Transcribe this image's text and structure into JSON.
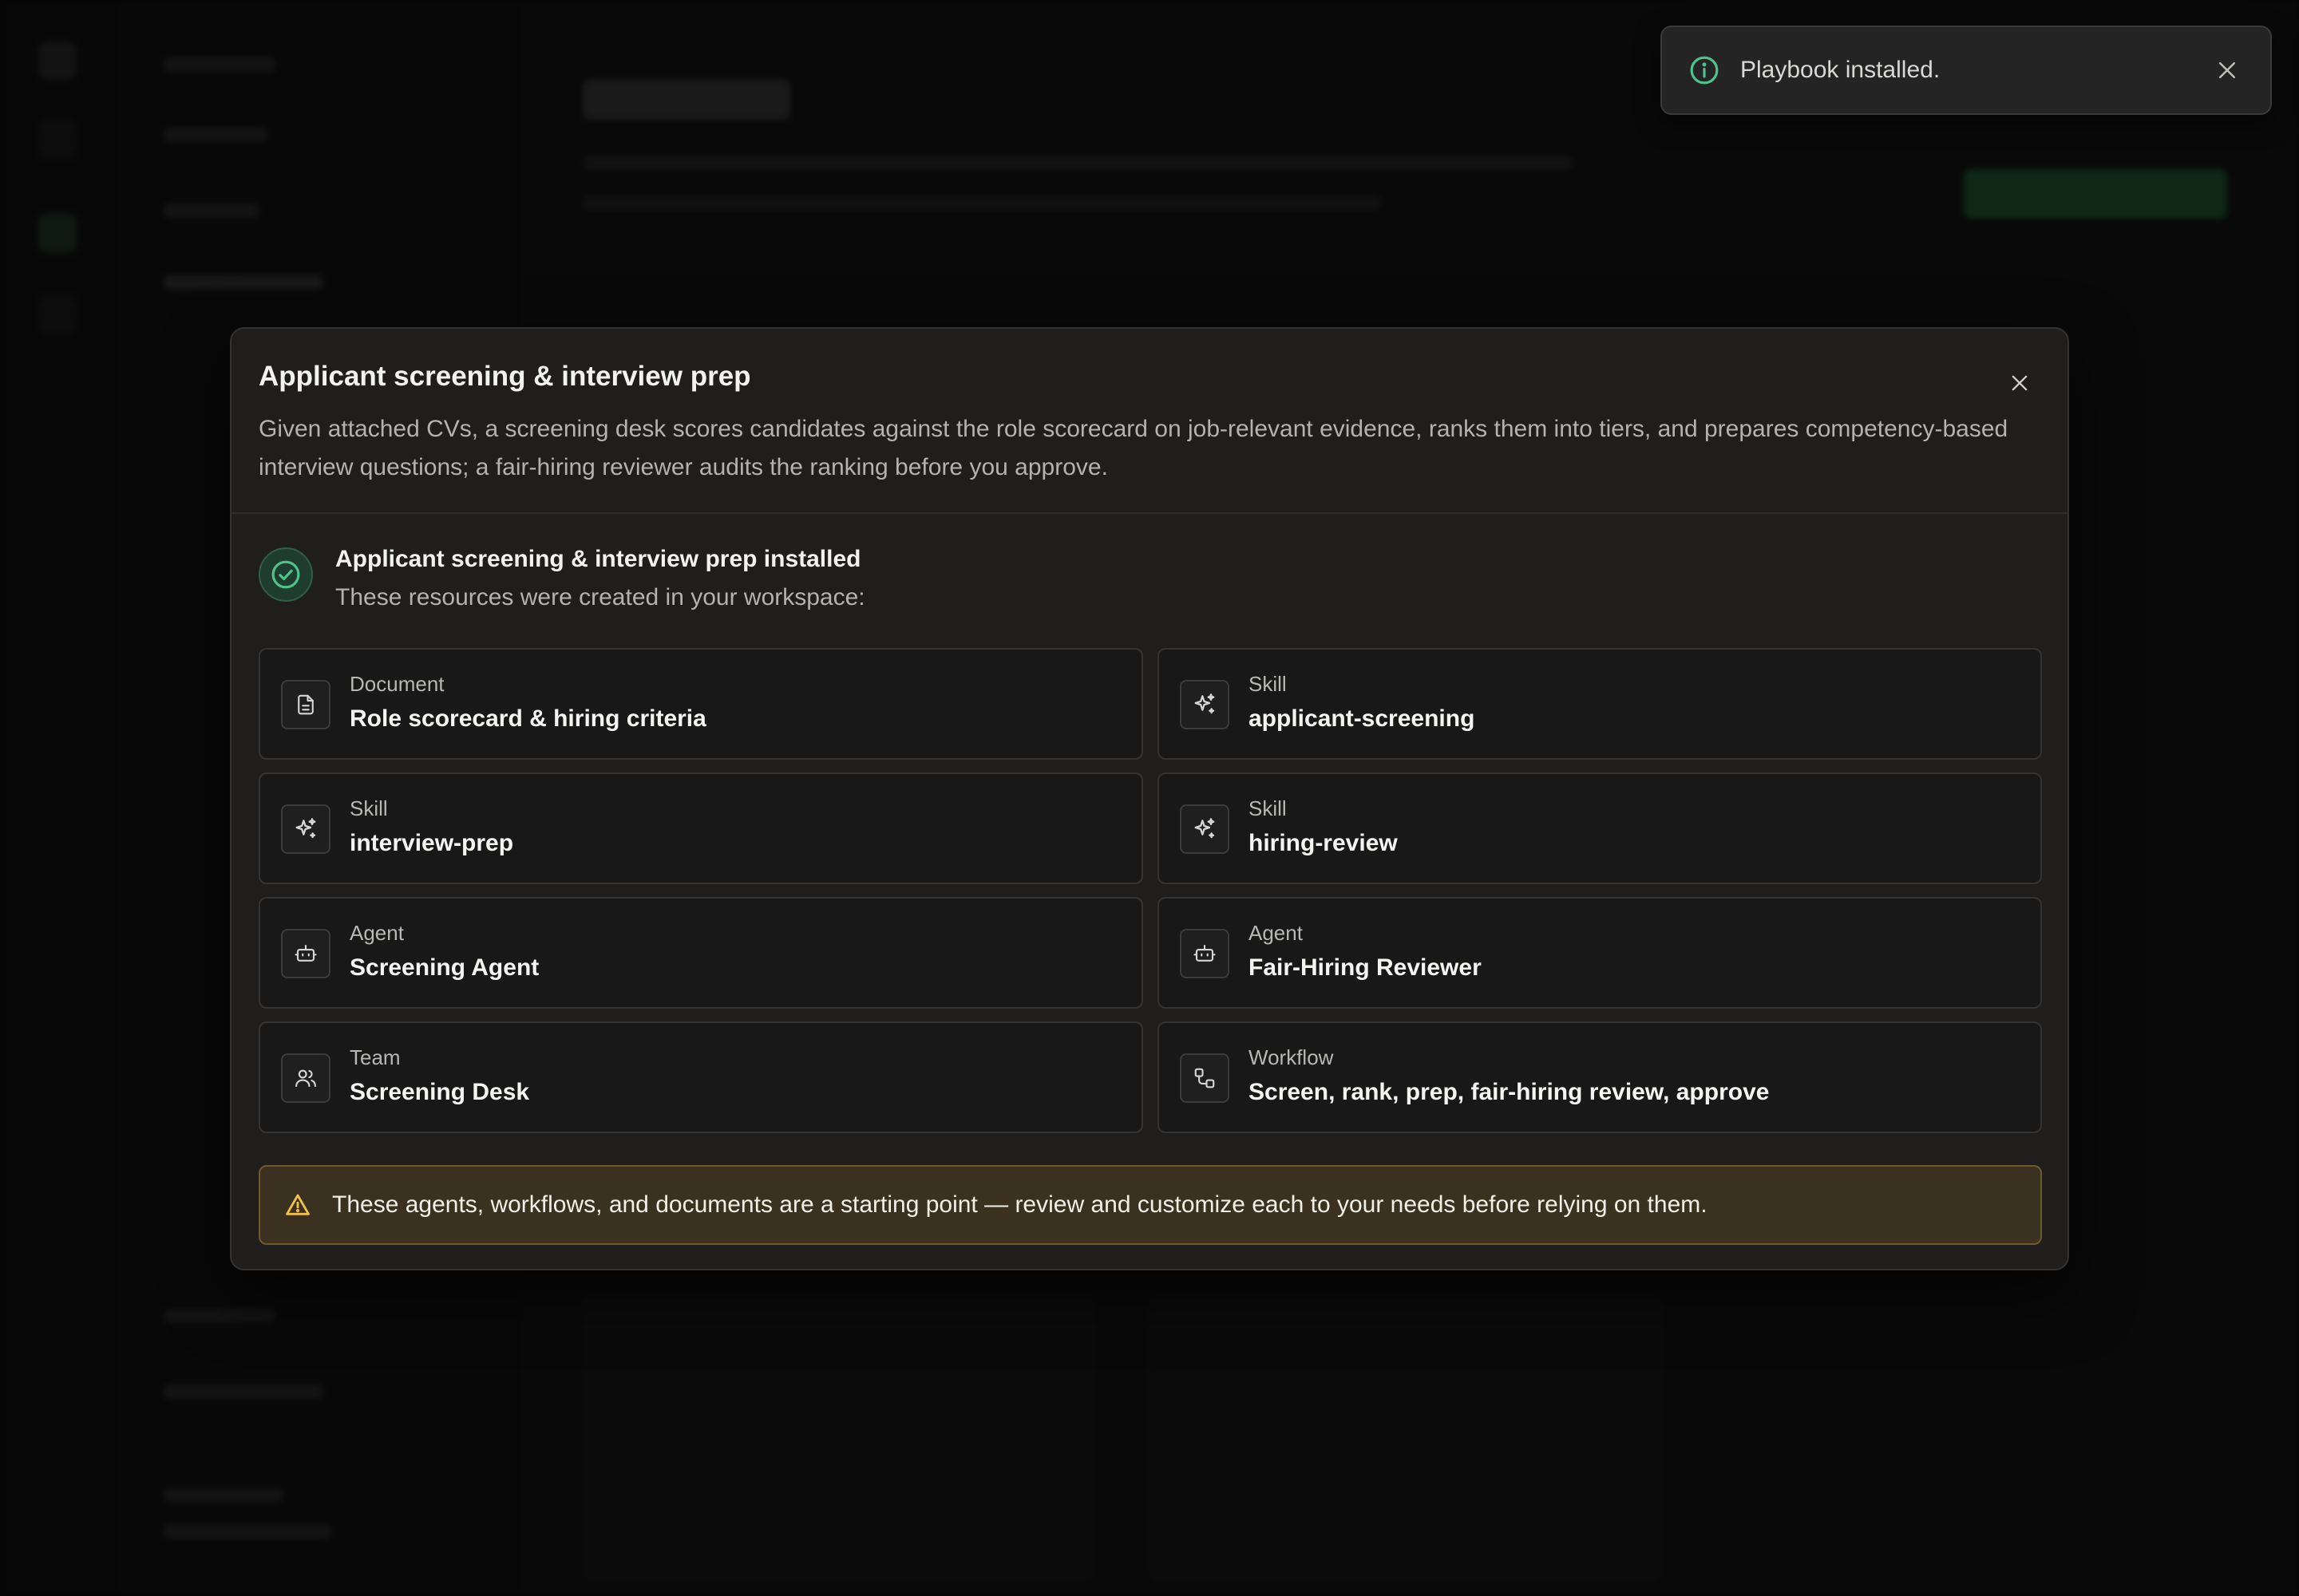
{
  "toast": {
    "message": "Playbook installed.",
    "icon": "info-icon",
    "close_icon": "close-icon"
  },
  "modal": {
    "title": "Applicant screening & interview prep",
    "description": "Given attached CVs, a screening desk scores candidates against the role scorecard on job-relevant evidence, ranks them into tiers, and prepares competency-based interview questions; a fair-hiring reviewer audits the ranking before you approve.",
    "close_icon": "close-icon",
    "success": {
      "icon": "check-circle-icon",
      "title": "Applicant screening & interview prep installed",
      "subtitle": "These resources were created in your workspace:"
    },
    "resources": [
      {
        "type": "Document",
        "name": "Role scorecard & hiring criteria",
        "icon": "document-icon"
      },
      {
        "type": "Skill",
        "name": "applicant-screening",
        "icon": "sparkles-icon"
      },
      {
        "type": "Skill",
        "name": "interview-prep",
        "icon": "sparkles-icon"
      },
      {
        "type": "Skill",
        "name": "hiring-review",
        "icon": "sparkles-icon"
      },
      {
        "type": "Agent",
        "name": "Screening Agent",
        "icon": "bot-icon"
      },
      {
        "type": "Agent",
        "name": "Fair-Hiring Reviewer",
        "icon": "bot-icon"
      },
      {
        "type": "Team",
        "name": "Screening Desk",
        "icon": "users-icon"
      },
      {
        "type": "Workflow",
        "name": "Screen, rank, prep, fair-hiring review, approve",
        "icon": "workflow-icon"
      }
    ],
    "warning": {
      "icon": "warning-icon",
      "text": "These agents, workflows, and documents are a starting point — review and customize each to your needs before relying on them."
    }
  },
  "colors": {
    "accent_green": "#4fc38a",
    "warning_bg": "#3a3120",
    "warning_border": "#6e5a2c",
    "warning_icon": "#f0c24a",
    "modal_bg": "#1f1e1d"
  }
}
